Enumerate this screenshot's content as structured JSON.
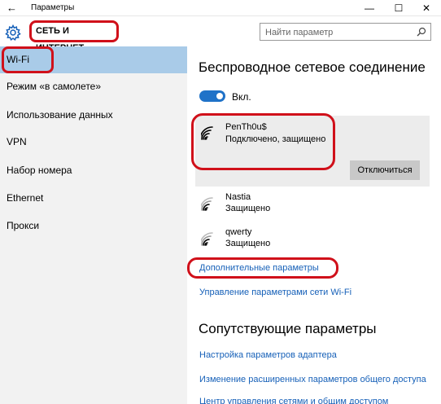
{
  "window": {
    "back_glyph": "←",
    "title": "Параметры",
    "minimize_glyph": "—",
    "maximize_glyph": "☐",
    "close_glyph": "✕"
  },
  "header": {
    "section_title": "СЕТЬ И ИНТЕРНЕТ",
    "search_placeholder": "Найти параметр"
  },
  "sidebar": {
    "items": [
      {
        "label": "Wi-Fi",
        "selected": true
      },
      {
        "label": "Режим «в самолете»"
      },
      {
        "label": "Использование данных"
      },
      {
        "label": "VPN"
      },
      {
        "label": "Набор номера"
      },
      {
        "label": "Ethernet"
      },
      {
        "label": "Прокси"
      }
    ]
  },
  "main": {
    "heading": "Беспроводное сетевое соединение",
    "toggle": {
      "label": "Вкл.",
      "on": true
    },
    "connected_network": {
      "name": "PenTh0u$",
      "status": "Подключено, защищено",
      "disconnect_label": "Отключиться"
    },
    "networks": [
      {
        "name": "Nastia",
        "status": "Защищено"
      },
      {
        "name": "qwerty",
        "status": "Защищено"
      }
    ],
    "links": {
      "advanced": "Дополнительные параметры",
      "manage": "Управление параметрами сети Wi-Fi"
    },
    "related": {
      "heading": "Сопутствующие параметры",
      "links": [
        "Настройка параметров адаптера",
        "Изменение расширенных параметров общего доступа",
        "Центр управления сетями и общим доступом"
      ]
    }
  },
  "colors": {
    "accent": "#1f72c8",
    "link": "#1660b8",
    "selected_nav": "#a9cbe8",
    "annotation": "#d0101a"
  },
  "icons": {
    "back": "back-arrow-icon",
    "settings": "gear-icon",
    "search": "search-icon",
    "wifi": "wifi-signal-icon"
  }
}
